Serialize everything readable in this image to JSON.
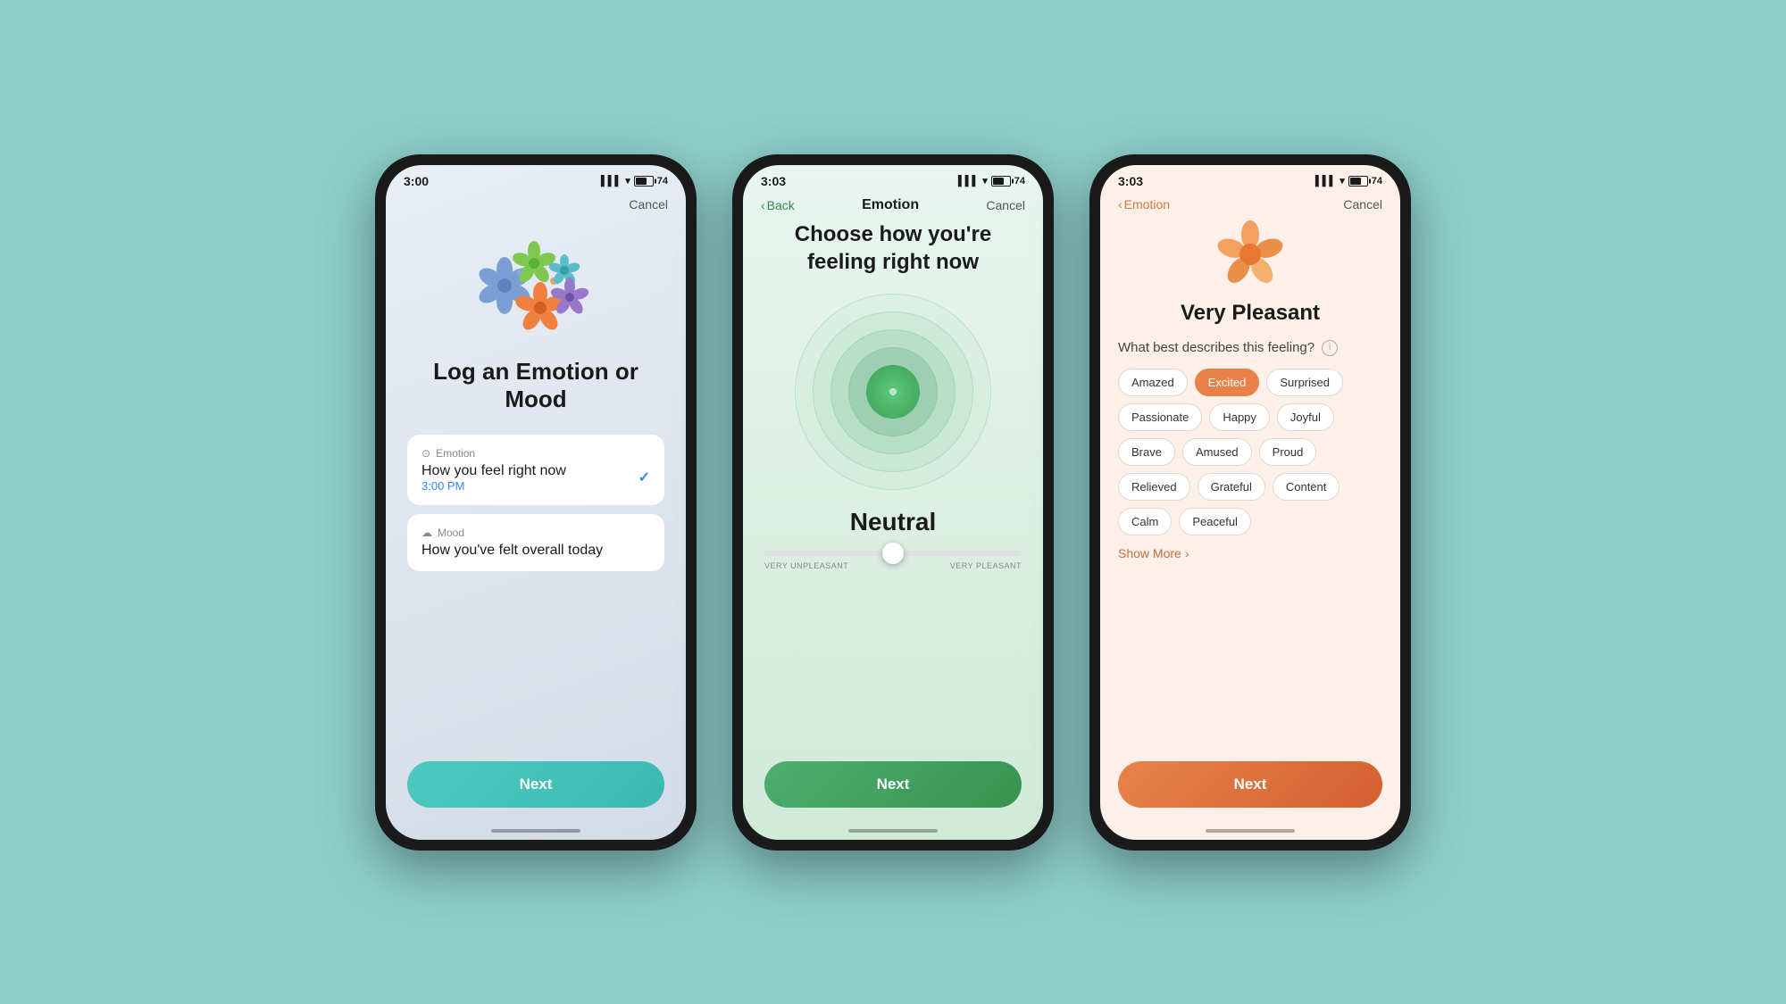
{
  "background_color": "#8ecfca",
  "phone1": {
    "status": {
      "time": "3:00",
      "battery": "74"
    },
    "nav": {
      "cancel": "Cancel"
    },
    "flowers": [
      "blue-purple",
      "green",
      "orange-dot",
      "teal",
      "orange",
      "purple"
    ],
    "title": "Log an Emotion\nor Mood",
    "emotion_option": {
      "icon": "⊙",
      "label": "Emotion",
      "description": "How you feel right now",
      "time": "3:00 PM",
      "selected": true
    },
    "mood_option": {
      "icon": "☁",
      "label": "Mood",
      "description": "How you've felt overall today"
    },
    "next_button": "Next"
  },
  "phone2": {
    "status": {
      "time": "3:03",
      "battery": "74"
    },
    "nav": {
      "back": "Back",
      "title": "Emotion",
      "cancel": "Cancel"
    },
    "title": "Choose how you're feeling\nright now",
    "current_feeling": "Neutral",
    "slider": {
      "min_label": "Very Unpleasant",
      "max_label": "Very Pleasant",
      "position": 50
    },
    "next_button": "Next"
  },
  "phone3": {
    "status": {
      "time": "3:03",
      "battery": "74"
    },
    "nav": {
      "back": "Emotion",
      "cancel": "Cancel"
    },
    "feeling_level": "Very Pleasant",
    "question": "What best describes this feeling?",
    "tags": [
      {
        "label": "Amazed",
        "selected": false
      },
      {
        "label": "Excited",
        "selected": true
      },
      {
        "label": "Surprised",
        "selected": false
      },
      {
        "label": "Passionate",
        "selected": false
      },
      {
        "label": "Happy",
        "selected": false
      },
      {
        "label": "Joyful",
        "selected": false
      },
      {
        "label": "Brave",
        "selected": false
      },
      {
        "label": "Amused",
        "selected": false
      },
      {
        "label": "Proud",
        "selected": false
      },
      {
        "label": "Relieved",
        "selected": false
      },
      {
        "label": "Grateful",
        "selected": false
      },
      {
        "label": "Content",
        "selected": false
      },
      {
        "label": "Calm",
        "selected": false
      },
      {
        "label": "Peaceful",
        "selected": false
      }
    ],
    "show_more": "Show More",
    "next_button": "Next"
  }
}
